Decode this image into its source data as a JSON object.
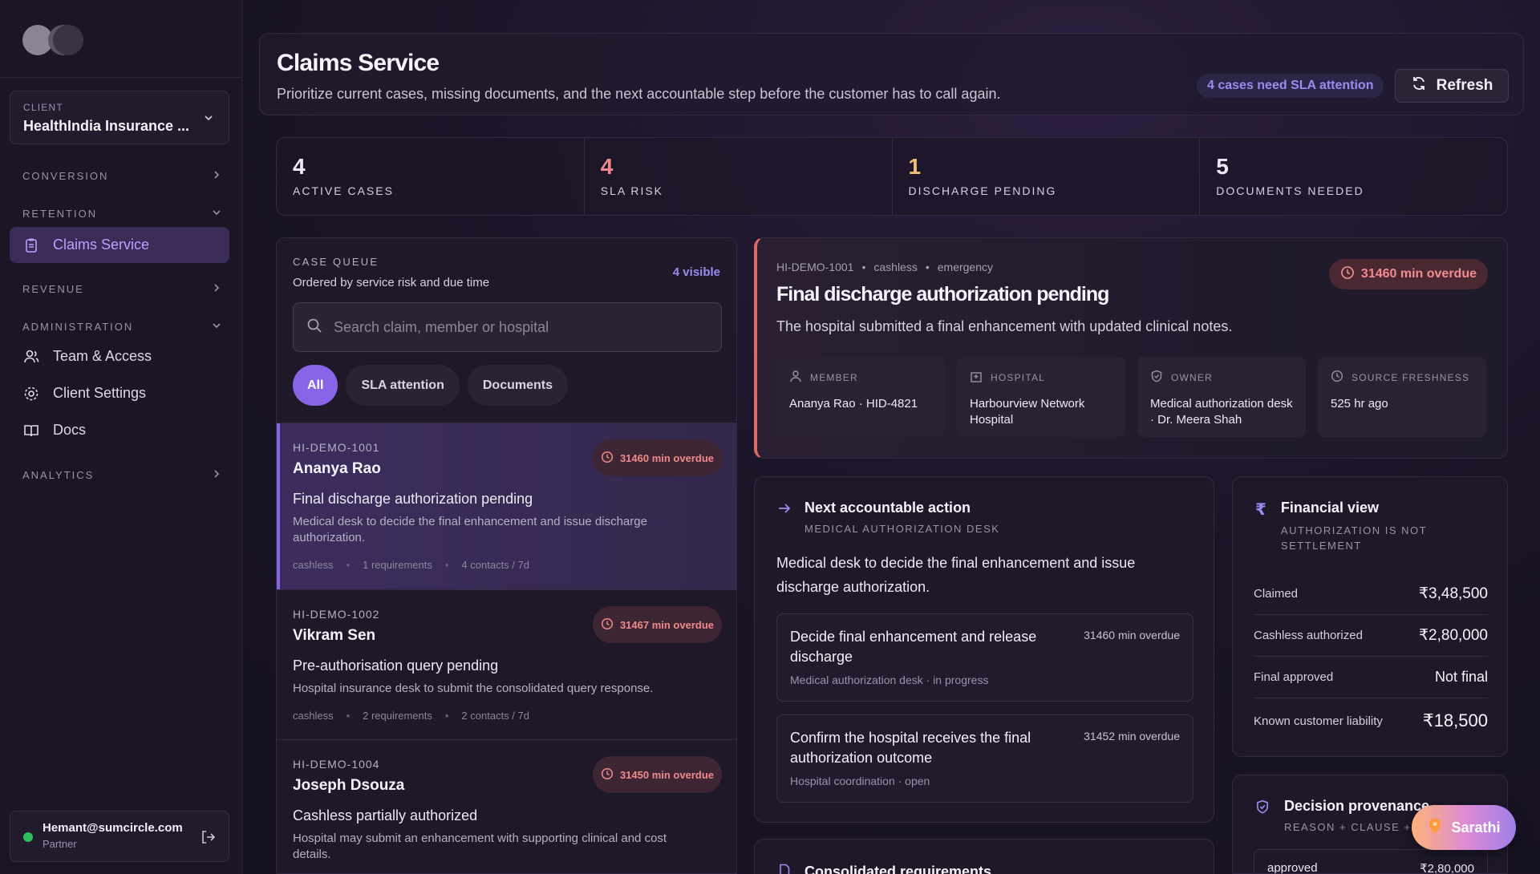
{
  "sidebar": {
    "client_label": "CLIENT",
    "client_value": "HealthIndia Insurance ...",
    "sections": {
      "conversion": "CONVERSION",
      "retention": "RETENTION",
      "revenue": "REVENUE",
      "administration": "ADMINISTRATION",
      "analytics": "ANALYTICS"
    },
    "items": {
      "claims": "Claims Service",
      "team": "Team & Access",
      "client_settings": "Client Settings",
      "docs": "Docs"
    },
    "user": {
      "email": "Hemant@sumcircle.com",
      "role": "Partner"
    }
  },
  "header": {
    "title": "Claims Service",
    "subtitle": "Prioritize current cases, missing documents, and the next accountable step before the customer has to call again.",
    "sla_badge": "4 cases need SLA attention",
    "refresh": "Refresh"
  },
  "stats": [
    {
      "value": "4",
      "label": "ACTIVE CASES",
      "color": "#f6f3fb"
    },
    {
      "value": "4",
      "label": "SLA RISK",
      "color": "#f08a8a"
    },
    {
      "value": "1",
      "label": "DISCHARGE PENDING",
      "color": "#f0c070"
    },
    {
      "value": "5",
      "label": "DOCUMENTS NEEDED",
      "color": "#f6f3fb"
    }
  ],
  "queue": {
    "title": "CASE QUEUE",
    "subtitle": "Ordered by service risk and due time",
    "visible": "4 visible",
    "search_placeholder": "Search claim, member or hospital",
    "filters": [
      "All",
      "SLA attention",
      "Documents"
    ],
    "cases": [
      {
        "id": "HI-DEMO-1001",
        "name": "Ananya Rao",
        "title": "Final discharge authorization pending",
        "desc": "Medical desk to decide the final enhancement and issue discharge authorization.",
        "overdue": "31460 min overdue",
        "meta": [
          "cashless",
          "1 requirements",
          "4 contacts / 7d"
        ]
      },
      {
        "id": "HI-DEMO-1002",
        "name": "Vikram Sen",
        "title": "Pre-authorisation query pending",
        "desc": "Hospital insurance desk to submit the consolidated query response.",
        "overdue": "31467 min overdue",
        "meta": [
          "cashless",
          "2 requirements",
          "2 contacts / 7d"
        ]
      },
      {
        "id": "HI-DEMO-1004",
        "name": "Joseph Dsouza",
        "title": "Cashless partially authorized",
        "desc": "Hospital may submit an enhancement with supporting clinical and cost details.",
        "overdue": "31450 min overdue",
        "meta": []
      }
    ]
  },
  "detail": {
    "crumb": [
      "HI-DEMO-1001",
      "cashless",
      "emergency"
    ],
    "title": "Final discharge authorization pending",
    "desc": "The hospital submitted a final enhancement with updated clinical notes.",
    "overdue": "31460 min overdue",
    "cards": [
      {
        "label": "MEMBER",
        "value": "Ananya Rao · HID-4821"
      },
      {
        "label": "HOSPITAL",
        "value": "Harbourview Network Hospital"
      },
      {
        "label": "OWNER",
        "value": "Medical authorization desk · Dr. Meera Shah"
      },
      {
        "label": "SOURCE FRESHNESS",
        "value": "525 hr ago"
      }
    ]
  },
  "next_action": {
    "title": "Next accountable action",
    "subtitle": "MEDICAL AUTHORIZATION DESK",
    "desc": "Medical desk to decide the final enhancement and issue discharge authorization.",
    "tasks": [
      {
        "title": "Decide final enhancement and release discharge",
        "sub": "Medical authorization desk · in progress",
        "overdue": "31460 min overdue"
      },
      {
        "title": "Confirm the hospital receives the final authorization outcome",
        "sub": "Hospital coordination · open",
        "overdue": "31452 min overdue"
      }
    ]
  },
  "financial": {
    "title": "Financial view",
    "subtitle": "AUTHORIZATION IS NOT SETTLEMENT",
    "rows": [
      {
        "k": "Claimed",
        "v": "₹3,48,500"
      },
      {
        "k": "Cashless authorized",
        "v": "₹2,80,000"
      },
      {
        "k": "Final approved",
        "v": "Not final"
      },
      {
        "k": "Known customer liability",
        "v": "₹18,500"
      }
    ]
  },
  "provenance": {
    "title": "Decision provenance",
    "subtitle": "REASON + CLAUSE + P",
    "line_k": "approved",
    "line_v": "₹2,80,000"
  },
  "requirements": {
    "title": "Consolidated requirements"
  },
  "assistant": {
    "label": "Sarathi"
  }
}
